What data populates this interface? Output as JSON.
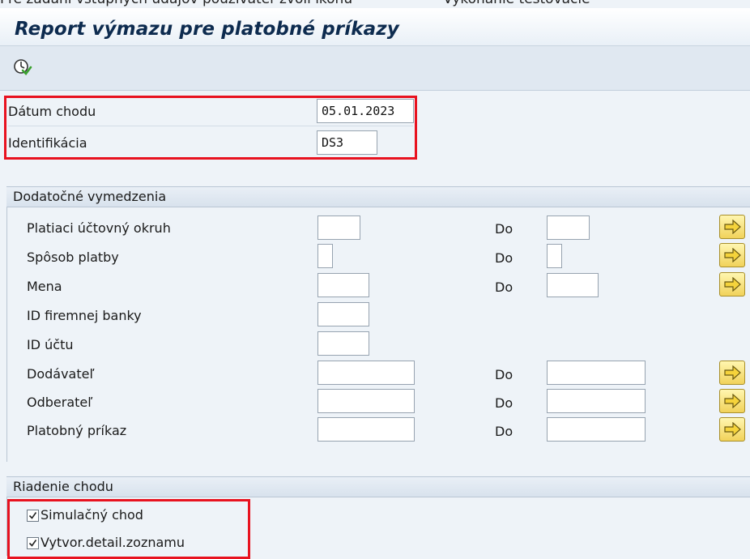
{
  "cut_top_text": {
    "left": "Pre zadaní vstupných údajov používateľ zvolí ikonu",
    "right": "Vykonanie testovacie"
  },
  "window": {
    "title": "Report výmazu pre platobné príkazy"
  },
  "toolbar": {
    "execute_icon": "execute-icon"
  },
  "header_fields": {
    "run_date": {
      "label": "Dátum chodu",
      "value": "05.01.2023"
    },
    "identification": {
      "label": "Identifikácia",
      "value": "DS3"
    }
  },
  "additional": {
    "section_title": "Dodatočné vymedzenia",
    "to_label": "Do",
    "rows": [
      {
        "label": "Platiaci účtovný okruh",
        "from": "",
        "to": ""
      },
      {
        "label": "Spôsob platby",
        "from": "",
        "to": ""
      },
      {
        "label": "Mena",
        "from": "",
        "to": ""
      },
      {
        "label": "ID firemnej banky",
        "from": ""
      },
      {
        "label": "ID účtu",
        "from": ""
      },
      {
        "label": "Dodávateľ",
        "from": "",
        "to": ""
      },
      {
        "label": "Odberateľ",
        "from": "",
        "to": ""
      },
      {
        "label": "Platobný príkaz",
        "from": "",
        "to": ""
      }
    ]
  },
  "run_control": {
    "section_title": "Riadenie chodu",
    "simulation": {
      "label": "Simulačný chod",
      "checked": true
    },
    "detail_list": {
      "label": "Vytvor.detail.zoznamu",
      "checked": true
    }
  },
  "colors": {
    "highlight_box": "#e8121f",
    "title": "#0d2b4f",
    "more_button": "#f1d25a"
  }
}
